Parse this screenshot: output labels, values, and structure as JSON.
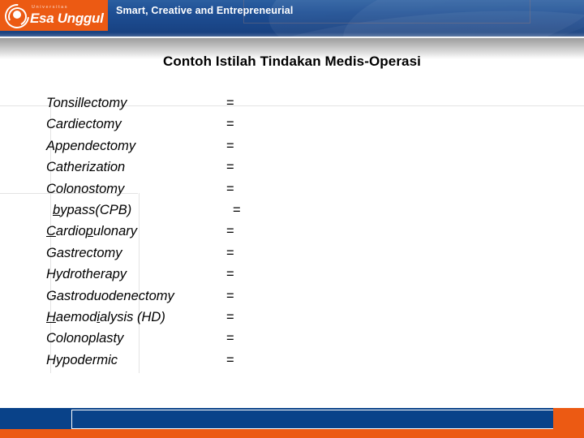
{
  "header": {
    "logo": {
      "university_label": "Universitas",
      "name": "Esa Unggul",
      "icon": "esa-unggul-circle-emblem"
    },
    "tagline": "Smart, Creative and Entrepreneurial",
    "colors": {
      "orange": "#ec5a13",
      "blue": "#1a4688",
      "footer_blue": "#094289"
    }
  },
  "slide": {
    "title": "Contoh Istilah Tindakan Medis-Operasi",
    "terms": [
      {
        "name": "Tonsillectomy",
        "equals": "=",
        "indent": false,
        "marked": []
      },
      {
        "name": "Cardiectomy",
        "equals": "=",
        "indent": false,
        "marked": []
      },
      {
        "name": "Appendectomy",
        "equals": "=",
        "indent": false,
        "marked": []
      },
      {
        "name": "Catherization",
        "equals": "=",
        "indent": false,
        "marked": []
      },
      {
        "name": "Colonostomy",
        "equals": "=",
        "indent": false,
        "marked": []
      },
      {
        "name": "bypass(CPB)",
        "equals": "=",
        "indent": true,
        "marked": [
          0
        ]
      },
      {
        "name": "Cardiopulonary",
        "equals": "=",
        "indent": false,
        "marked": [
          0,
          6
        ]
      },
      {
        "name": "Gastrectomy",
        "equals": "=",
        "indent": false,
        "marked": []
      },
      {
        "name": "Hydrotherapy",
        "equals": "=",
        "indent": false,
        "marked": []
      },
      {
        "name": "Gastroduodenectomy",
        "equals": "=",
        "indent": false,
        "marked": []
      },
      {
        "name": "Haemodialysis (HD)",
        "equals": "=",
        "indent": false,
        "marked": [
          0,
          6
        ]
      },
      {
        "name": "Colonoplasty",
        "equals": "=",
        "indent": false,
        "marked": []
      },
      {
        "name": "Hypodermic",
        "equals": "=",
        "indent": false,
        "marked": []
      }
    ]
  }
}
